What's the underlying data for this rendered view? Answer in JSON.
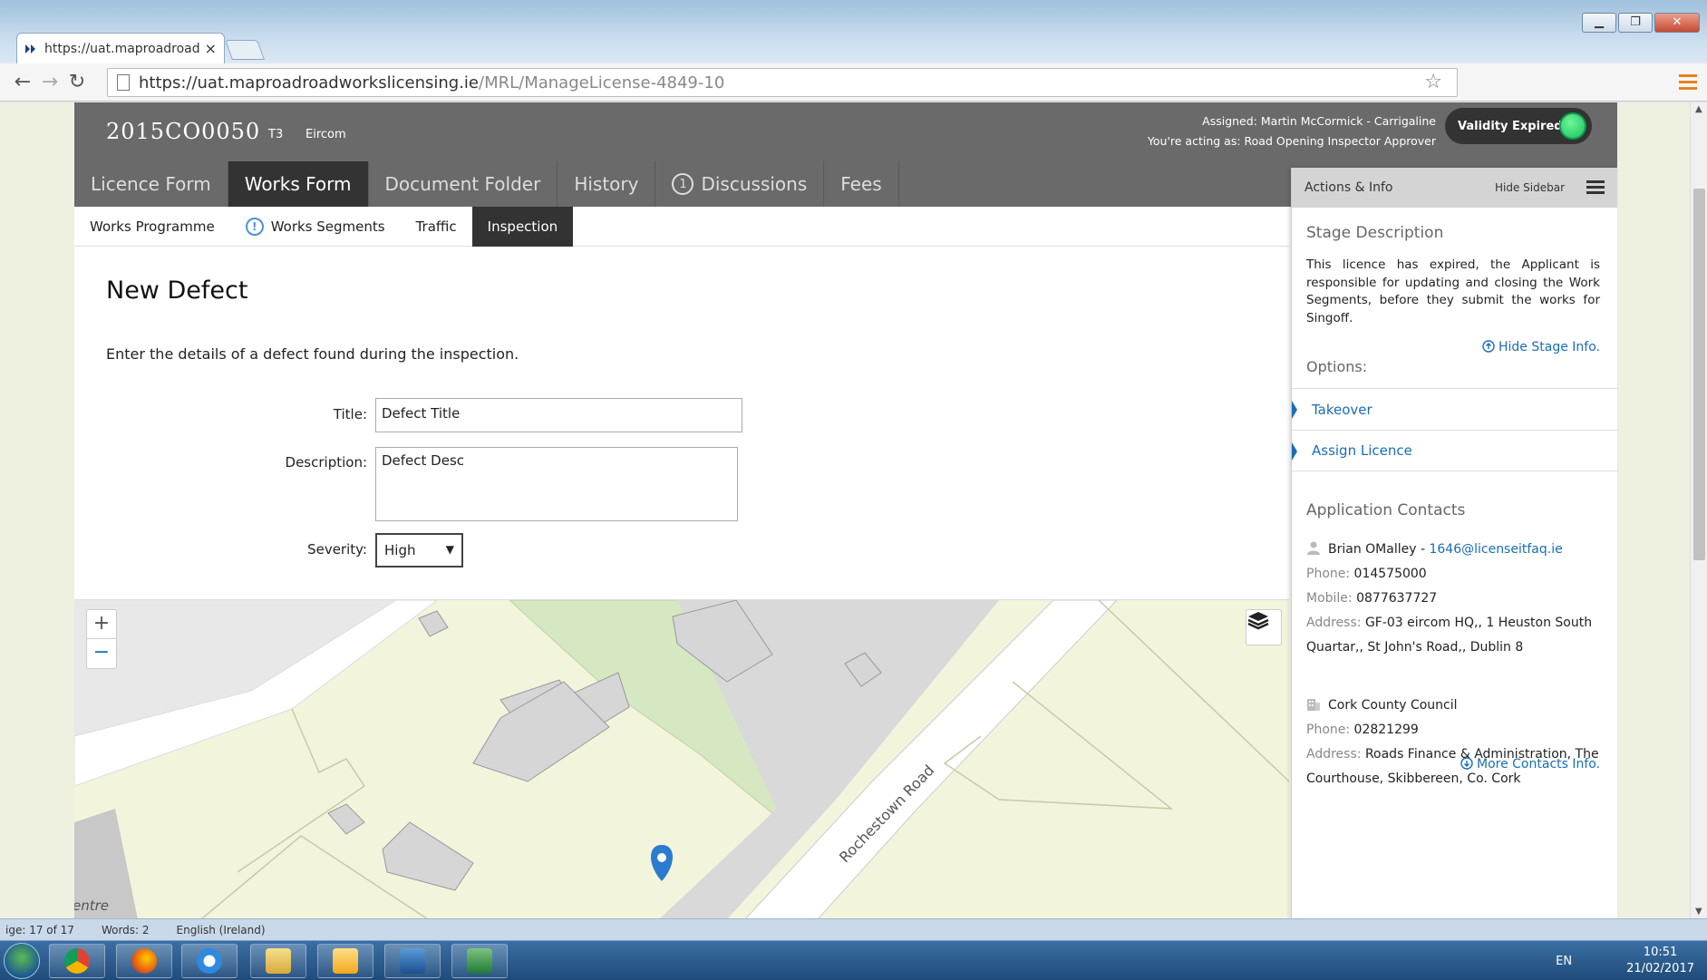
{
  "browser": {
    "tab_title": "https://uat.maproadroadw",
    "tab_close": "×",
    "url_host": "https://uat.maproadroadworkslicensing.ie",
    "url_path": "/MRL/ManageLicense-4849-10",
    "back": "←",
    "forward": "→",
    "reload": "↻",
    "star": "☆",
    "min": "▁",
    "max": "❐",
    "close": "✕"
  },
  "header": {
    "licence_number": "2015CO0050",
    "licence_type": "T3",
    "company": "Eircom",
    "assigned_label": "Assigned:",
    "assigned_value": "Martin McCormick - Carrigaline",
    "acting_label": "You're acting as:",
    "acting_value": "Road Opening Inspector Approver",
    "validity": "Validity Expired"
  },
  "main_tabs": [
    {
      "label": "Licence Form"
    },
    {
      "label": "Works Form"
    },
    {
      "label": "Document Folder"
    },
    {
      "label": "History"
    },
    {
      "label": "Discussions",
      "badge": "1"
    },
    {
      "label": "Fees"
    }
  ],
  "sub_tabs": [
    {
      "label": "Works Programme"
    },
    {
      "label": "Works Segments",
      "badge": "!"
    },
    {
      "label": "Traffic"
    },
    {
      "label": "Inspection"
    }
  ],
  "form": {
    "page_title": "New Defect",
    "intro": "Enter the details of a defect found during the inspection.",
    "title_label": "Title:",
    "title_value": "Defect Title",
    "description_label": "Description:",
    "description_value": "Defect Desc",
    "severity_label": "Severity:",
    "severity_value": "High",
    "severity_caret": "▼"
  },
  "map": {
    "zoom_in": "+",
    "zoom_out": "−",
    "road_label": "Rochestown Road",
    "place_label": "entre"
  },
  "sidebar": {
    "title": "Actions & Info",
    "hide_label": "Hide Sidebar",
    "stage_title": "Stage Description",
    "stage_text": "This licence has expired, the Applicant is responsible for updating and closing the Work Segments, before they submit the works for Singoff.",
    "hide_stage": "Hide Stage Info.",
    "options_title": "Options:",
    "options": [
      {
        "label": "Takeover"
      },
      {
        "label": "Assign Licence"
      }
    ],
    "contacts_title": "Application Contacts",
    "contact1": {
      "name": "Brian OMalley - ",
      "email": "1646@licenseitfaq.ie",
      "phone_label": "Phone:",
      "phone": "014575000",
      "mobile_label": "Mobile:",
      "mobile": "0877637727",
      "address_label": "Address:",
      "address": "GF-03 eircom HQ,, 1 Heuston South Quartar,, St John's Road,, Dublin 8"
    },
    "contact2": {
      "name": "Cork County Council",
      "phone_label": "Phone:",
      "phone": "02821299",
      "address_label": "Address:",
      "address": "Roads Finance & Administration, The Courthouse, Skibbereen, Co. Cork"
    },
    "more_contacts": "More Contacts Info."
  },
  "word_status": {
    "page": "ige: 17 of 17",
    "words": "Words: 2",
    "language": "English (Ireland)"
  },
  "taskbar": {
    "lang": "EN",
    "time": "10:51",
    "date": "21/02/2017"
  },
  "colors": {
    "header_bg": "#6a6a6a",
    "link": "#1a6db5",
    "validity_dot": "#16c160",
    "map_wood": "#d6e8c2",
    "map_land": "#f3f4dc"
  }
}
